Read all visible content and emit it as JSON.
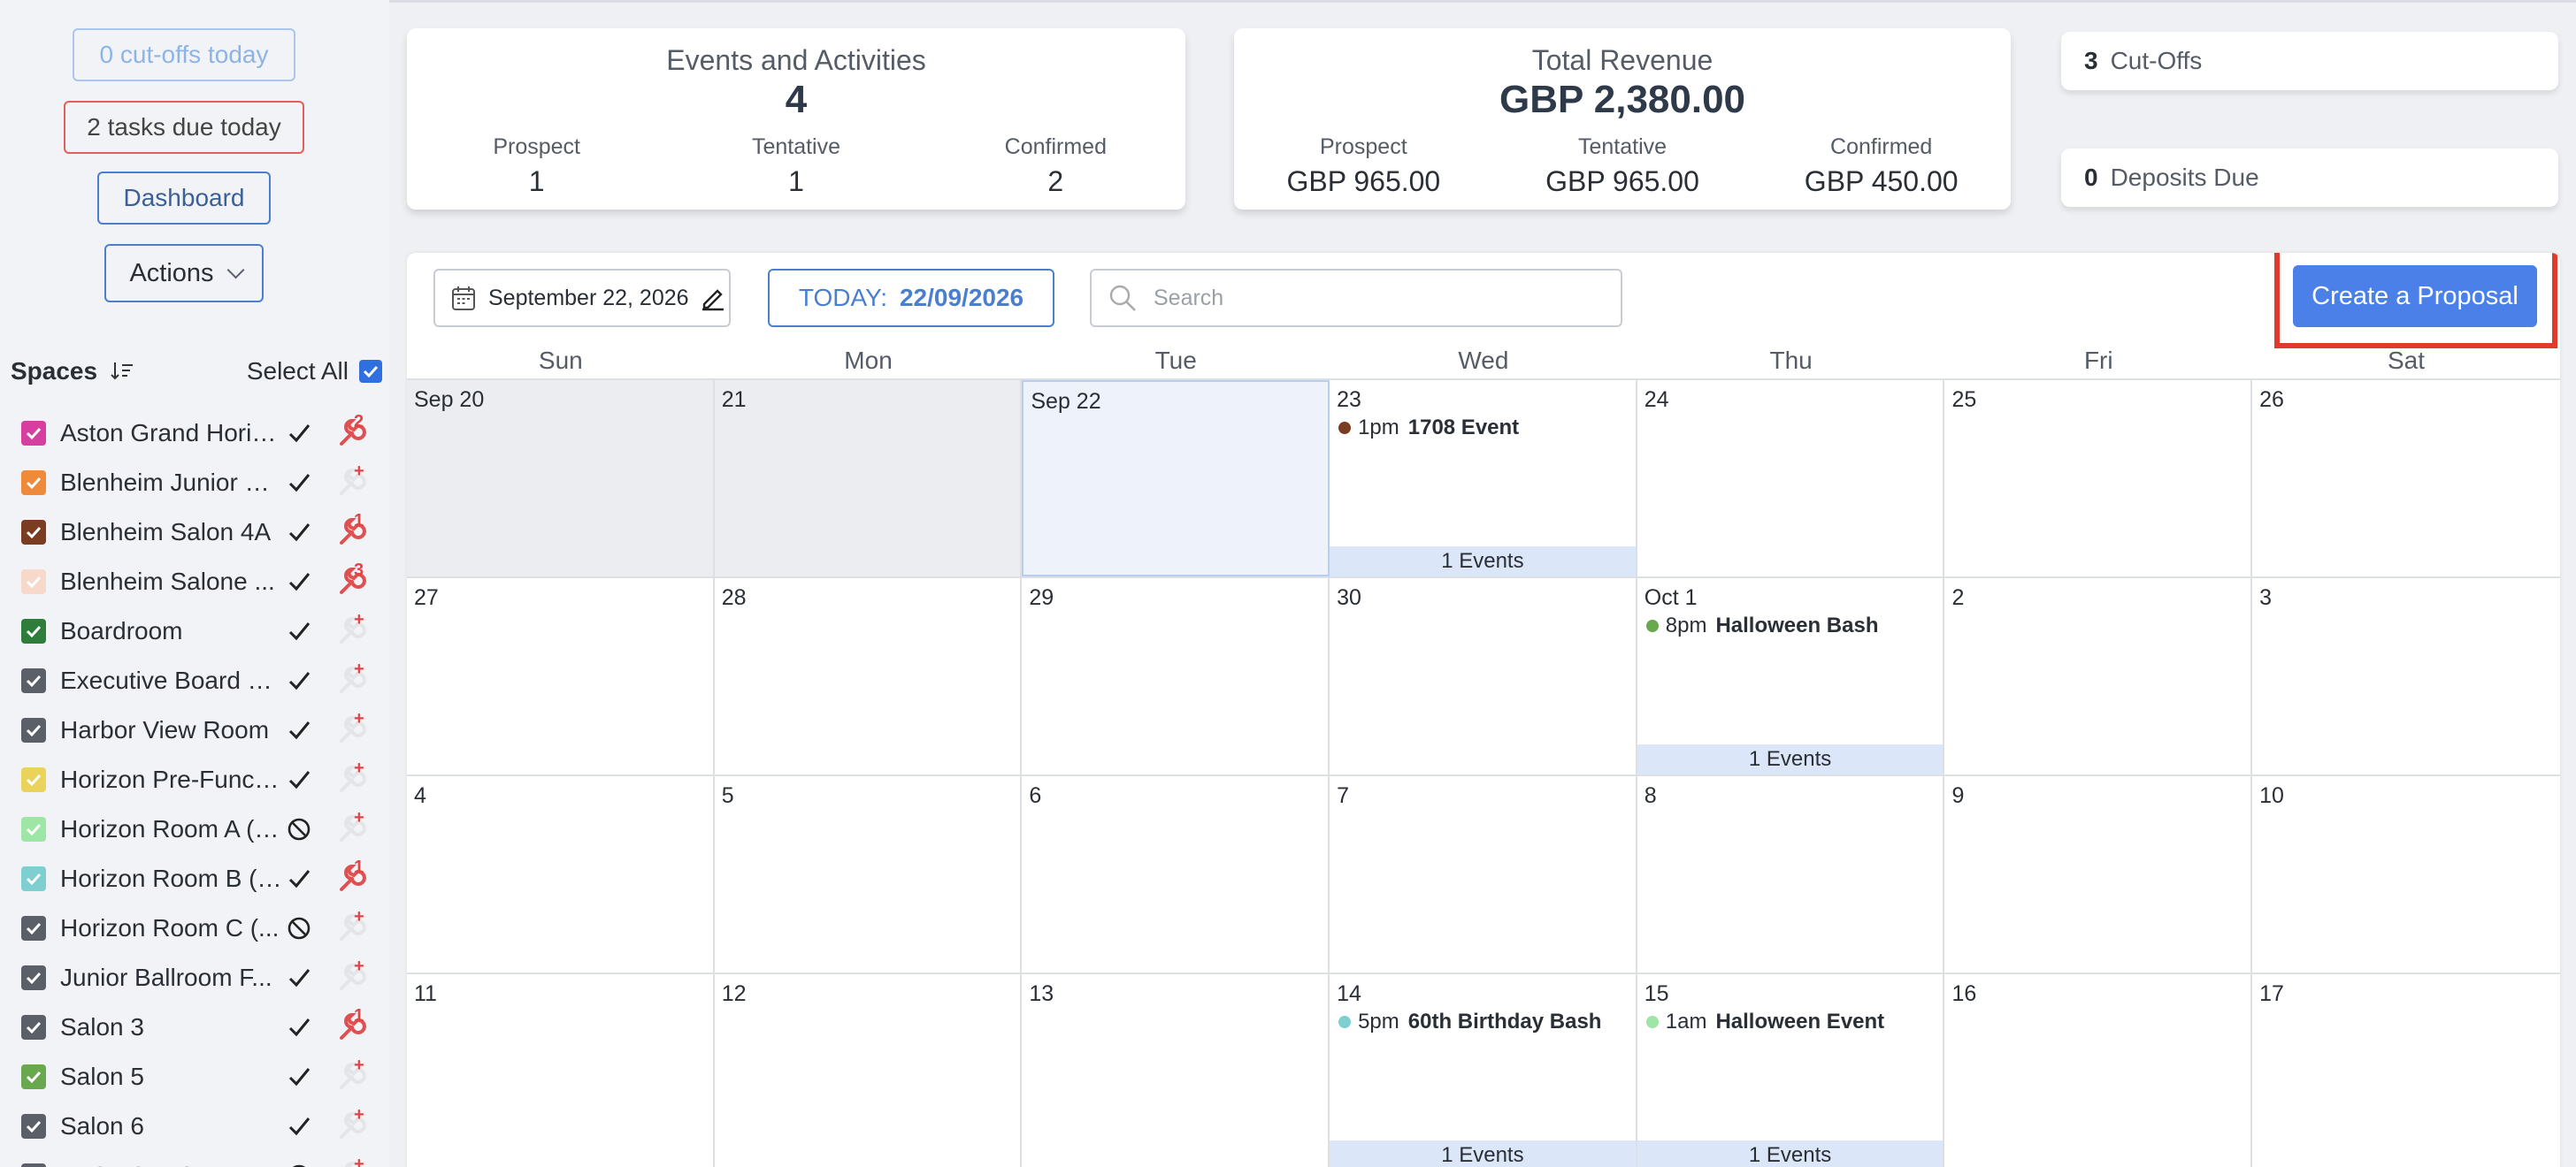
{
  "sidebar": {
    "cutoffs_label": "0 cut-offs today",
    "tasks_label": "2 tasks due today",
    "dashboard_label": "Dashboard",
    "actions_label": "Actions",
    "spaces_title": "Spaces",
    "select_all_label": "Select All",
    "spaces": [
      {
        "name": "Aston Grand Horizon",
        "color": "#d63ea0",
        "status": "check",
        "wrench": "active",
        "badge": "2"
      },
      {
        "name": "Blenheim Junior Ballroom",
        "color": "#ee8a3a",
        "status": "check",
        "wrench": "faded",
        "badge": "+"
      },
      {
        "name": "Blenheim Salon 4A",
        "color": "#7a3d22",
        "status": "check",
        "wrench": "active",
        "badge": "1"
      },
      {
        "name": "Blenheim Salone ...",
        "color": "#f7d9cc",
        "status": "check",
        "wrench": "active",
        "badge": "3"
      },
      {
        "name": "Boardroom",
        "color": "#2f7d3a",
        "status": "check",
        "wrench": "faded",
        "badge": "+"
      },
      {
        "name": "Executive Board Room",
        "color": "#5b5f68",
        "status": "check",
        "wrench": "faded",
        "badge": "+"
      },
      {
        "name": "Harbor View Room",
        "color": "#5b5f68",
        "status": "check",
        "wrench": "faded",
        "badge": "+"
      },
      {
        "name": "Horizon Pre-Function",
        "color": "#e9d35a",
        "status": "check",
        "wrench": "faded",
        "badge": "+"
      },
      {
        "name": "Horizon Room A (E...",
        "color": "#9ee6a6",
        "status": "blocked",
        "wrench": "faded",
        "badge": "+"
      },
      {
        "name": "Horizon Room B (C...",
        "color": "#7fcfd1",
        "status": "check",
        "wrench": "active",
        "badge": "1"
      },
      {
        "name": "Horizon Room C (...",
        "color": "#5b5f68",
        "status": "blocked",
        "wrench": "faded",
        "badge": "+"
      },
      {
        "name": "Junior Ballroom F...",
        "color": "#5b5f68",
        "status": "check",
        "wrench": "faded",
        "badge": "+"
      },
      {
        "name": "Salon 3",
        "color": "#5b5f68",
        "status": "check",
        "wrench": "active",
        "badge": "1"
      },
      {
        "name": "Salon 5",
        "color": "#6aa84f",
        "status": "check",
        "wrench": "faded",
        "badge": "+"
      },
      {
        "name": "Salon 6",
        "color": "#5b5f68",
        "status": "check",
        "wrench": "faded",
        "badge": "+"
      },
      {
        "name": "TEST SPACE",
        "color": "#5b5f68",
        "status": "blocked",
        "wrench": "faded",
        "badge": "+"
      }
    ]
  },
  "events_card": {
    "title": "Events and Activities",
    "total": "4",
    "cols": [
      {
        "label": "Prospect",
        "value": "1"
      },
      {
        "label": "Tentative",
        "value": "1"
      },
      {
        "label": "Confirmed",
        "value": "2"
      }
    ]
  },
  "revenue_card": {
    "title": "Total Revenue",
    "total": "GBP 2,380.00",
    "cols": [
      {
        "label": "Prospect",
        "value": "GBP 965.00"
      },
      {
        "label": "Tentative",
        "value": "GBP 965.00"
      },
      {
        "label": "Confirmed",
        "value": "GBP 450.00"
      }
    ]
  },
  "mini_cards": {
    "cutoffs": {
      "num": "3",
      "label": "Cut-Offs"
    },
    "deposits": {
      "num": "0",
      "label": "Deposits Due"
    }
  },
  "toolbar": {
    "date_label": "September 22, 2026",
    "today_prefix": "TODAY:",
    "today_date": "22/09/2026",
    "search_placeholder": "Search",
    "proposal_label": "Create a Proposal"
  },
  "calendar": {
    "days_of_week": [
      "Sun",
      "Mon",
      "Tue",
      "Wed",
      "Thu",
      "Fri",
      "Sat"
    ],
    "weeks": [
      [
        {
          "label": "Sep 20",
          "past": true
        },
        {
          "label": "21",
          "past": true
        },
        {
          "label": "Sep 22",
          "today": true
        },
        {
          "label": "23",
          "event": {
            "time": "1pm",
            "title": "1708 Event",
            "color": "#7a3d22"
          },
          "count": "1 Events"
        },
        {
          "label": "24"
        },
        {
          "label": "25"
        },
        {
          "label": "26"
        }
      ],
      [
        {
          "label": "27"
        },
        {
          "label": "28"
        },
        {
          "label": "29"
        },
        {
          "label": "30"
        },
        {
          "label": "Oct 1",
          "event": {
            "time": "8pm",
            "title": "Halloween Bash",
            "color": "#6aa84f"
          },
          "count": "1 Events"
        },
        {
          "label": "2"
        },
        {
          "label": "3"
        }
      ],
      [
        {
          "label": "4"
        },
        {
          "label": "5"
        },
        {
          "label": "6"
        },
        {
          "label": "7"
        },
        {
          "label": "8"
        },
        {
          "label": "9"
        },
        {
          "label": "10"
        }
      ],
      [
        {
          "label": "11"
        },
        {
          "label": "12"
        },
        {
          "label": "13"
        },
        {
          "label": "14",
          "event": {
            "time": "5pm",
            "title": "60th Birthday Bash",
            "color": "#7fcfd1"
          },
          "count": "1 Events"
        },
        {
          "label": "15",
          "event": {
            "time": "1am",
            "title": "Halloween Event",
            "color": "#9ee6a6"
          },
          "count": "1 Events"
        },
        {
          "label": "16"
        },
        {
          "label": "17"
        }
      ]
    ]
  }
}
